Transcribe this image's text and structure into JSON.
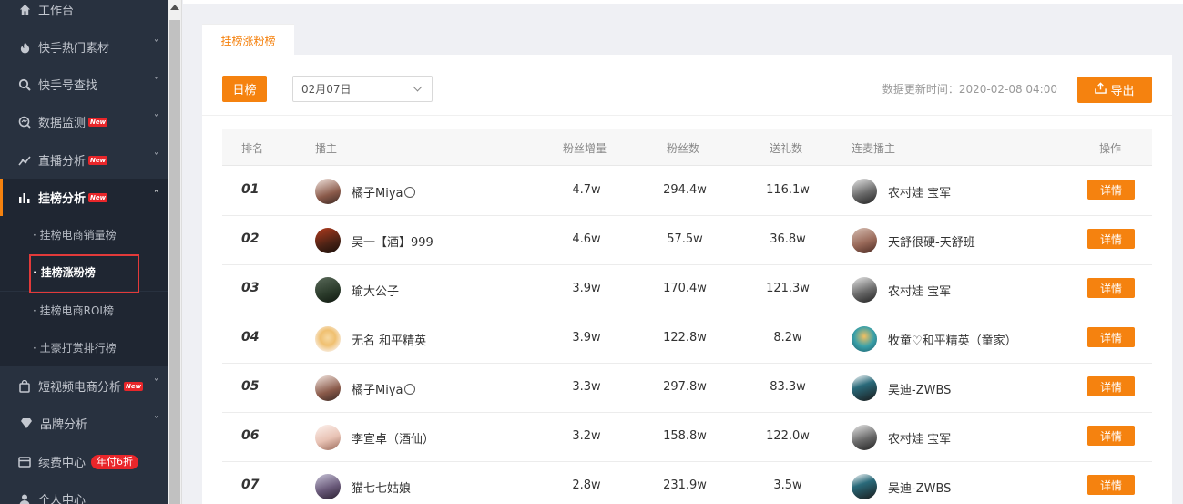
{
  "sidebar": {
    "items": [
      {
        "label": "工作台",
        "icon": "home-icon",
        "chevron": false
      },
      {
        "label": "快手热门素材",
        "icon": "fire-icon",
        "chevron": true
      },
      {
        "label": "快手号查找",
        "icon": "search-icon",
        "chevron": true
      },
      {
        "label": "数据监测",
        "icon": "monitor-icon",
        "chevron": true,
        "badge": "New"
      },
      {
        "label": "直播分析",
        "icon": "trend-icon",
        "chevron": true,
        "badge": "New"
      },
      {
        "label": "挂榜分析",
        "icon": "bar-chart-icon",
        "chevron": true,
        "badge": "New"
      },
      {
        "label": "短视频电商分析",
        "icon": "bag-icon",
        "chevron": true,
        "badge": "New"
      },
      {
        "label": "品牌分析",
        "icon": "diamond-icon",
        "chevron": true
      },
      {
        "label": "续费中心",
        "icon": "card-icon",
        "chevron": false,
        "badge_discount": "年付6折"
      },
      {
        "label": "个人中心",
        "icon": "user-icon",
        "chevron": false
      }
    ],
    "subitems": [
      {
        "label": "挂榜电商销量榜"
      },
      {
        "label": "挂榜涨粉榜"
      },
      {
        "label": "挂榜电商ROI榜"
      },
      {
        "label": "土豪打赏排行榜"
      }
    ],
    "chevron_glyph": "˅",
    "chevron_up_glyph": "˄"
  },
  "tab": {
    "label": "挂榜涨粉榜"
  },
  "toolbar": {
    "day_label": "日榜",
    "date_value": "02月07日",
    "update_label": "数据更新时间：2020-02-08 04:00",
    "export_label": "导出"
  },
  "table": {
    "headers": {
      "rank": "排名",
      "anchor": "播主",
      "fan_growth": "粉丝增量",
      "fans": "粉丝数",
      "gifts": "送礼数",
      "co_anchor": "连麦播主",
      "action": "操作"
    },
    "rows": [
      {
        "rank": "01",
        "anchor": "橘子Miya",
        "anchor_emoji": true,
        "fan_growth": "4.7w",
        "fans": "294.4w",
        "gifts": "116.1w",
        "co_anchor": "农村娃 宝军",
        "action": "详情"
      },
      {
        "rank": "02",
        "anchor": "吴一【酒】999",
        "fan_growth": "4.6w",
        "fans": "57.5w",
        "gifts": "36.8w",
        "co_anchor": "天舒很硬-天舒班",
        "action": "详情"
      },
      {
        "rank": "03",
        "anchor": "瑜大公子",
        "fan_growth": "3.9w",
        "fans": "170.4w",
        "gifts": "121.3w",
        "co_anchor": "农村娃 宝军",
        "action": "详情"
      },
      {
        "rank": "04",
        "anchor": "无名 和平精英",
        "fan_growth": "3.9w",
        "fans": "122.8w",
        "gifts": "8.2w",
        "co_anchor": "牧童♡和平精英（童家）",
        "action": "详情"
      },
      {
        "rank": "05",
        "anchor": "橘子Miya",
        "anchor_emoji": true,
        "fan_growth": "3.3w",
        "fans": "297.8w",
        "gifts": "83.3w",
        "co_anchor": "吴迪-ZWBS",
        "action": "详情"
      },
      {
        "rank": "06",
        "anchor": "李宣卓（酒仙）",
        "fan_growth": "3.2w",
        "fans": "158.8w",
        "gifts": "122.0w",
        "co_anchor": "农村娃 宝军",
        "action": "详情"
      },
      {
        "rank": "07",
        "anchor": "猫七七姑娘",
        "fan_growth": "2.8w",
        "fans": "231.9w",
        "gifts": "3.5w",
        "co_anchor": "吴迪-ZWBS",
        "action": "详情"
      }
    ]
  },
  "colors": {
    "accent": "#f5820f",
    "sidebar_bg": "#28313f",
    "sidebar_sub_bg": "#1f2632",
    "badge_red": "#e9262a"
  }
}
